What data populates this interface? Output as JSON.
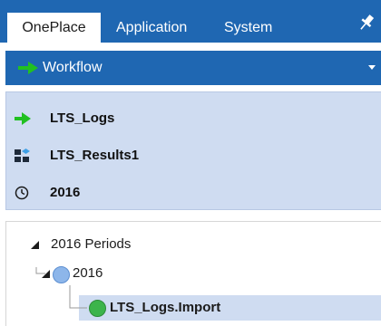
{
  "tabs": [
    {
      "label": "OnePlace",
      "active": true
    },
    {
      "label": "Application",
      "active": false
    },
    {
      "label": "System",
      "active": false
    }
  ],
  "workflow_bar": {
    "label": "Workflow",
    "icon": "green-arrow-icon"
  },
  "info_panel": {
    "workflow": {
      "label": "LTS_Logs",
      "icon": "green-arrow-icon"
    },
    "scenario": {
      "label": "LTS_Results1",
      "icon": "cube-icon"
    },
    "time": {
      "label": "2016",
      "icon": "clock-icon"
    }
  },
  "tree": {
    "root": {
      "label": "2016 Periods",
      "expanded": true
    },
    "child": {
      "label": "2016",
      "expanded": true
    },
    "leaf": {
      "label": "LTS_Logs.Import",
      "selected": true
    }
  },
  "colors": {
    "header_blue": "#1f67b2",
    "panel_blue": "#cfdcf1",
    "green": "#21c021",
    "node_blue": "#8db6ea",
    "status_green": "#3cb44b"
  }
}
